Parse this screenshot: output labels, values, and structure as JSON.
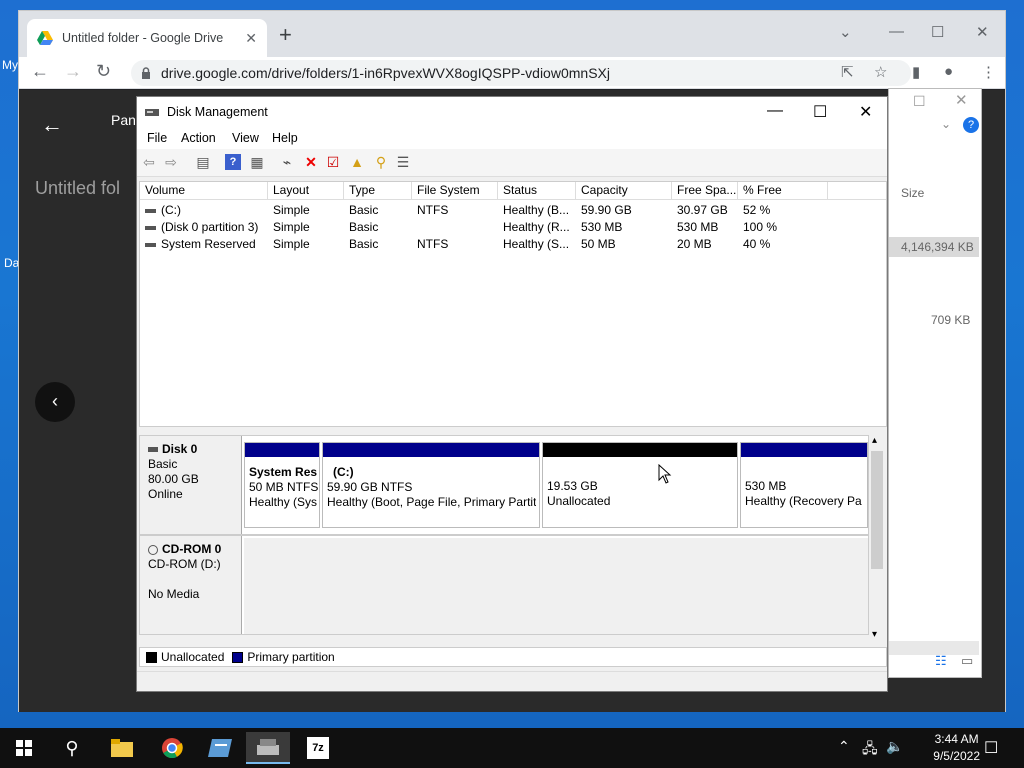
{
  "desktop": {
    "frag1": "My",
    "frag2": "Da"
  },
  "chrome": {
    "tab_title": "Untitled folder - Google Drive",
    "url": "drive.google.com/drive/folders/1-in6RpvexWVX8ogIQSPP-vdiow0mnSXj",
    "new_tab_label": "+",
    "drive_title": "Untitled fol",
    "drive_file_frag": "Pan"
  },
  "explorer": {
    "col_size": "Size",
    "size1": "4,146,394 KB",
    "size2": "709 KB"
  },
  "dm": {
    "title": "Disk Management",
    "menu": [
      "File",
      "Action",
      "View",
      "Help"
    ],
    "columns": [
      "Volume",
      "Layout",
      "Type",
      "File System",
      "Status",
      "Capacity",
      "Free Spa...",
      "% Free"
    ],
    "rows": [
      [
        "(C:)",
        "Simple",
        "Basic",
        "NTFS",
        "Healthy (B...",
        "59.90 GB",
        "30.97 GB",
        "52 %"
      ],
      [
        "(Disk 0 partition 3)",
        "Simple",
        "Basic",
        "",
        "Healthy (R...",
        "530 MB",
        "530 MB",
        "100 %"
      ],
      [
        "System Reserved",
        "Simple",
        "Basic",
        "NTFS",
        "Healthy (S...",
        "50 MB",
        "20 MB",
        "40 %"
      ]
    ],
    "disk0": {
      "name": "Disk 0",
      "type": "Basic",
      "size": "80.00 GB",
      "state": "Online"
    },
    "partitions": [
      {
        "name": "System Res",
        "size": "50 MB NTFS",
        "status": "Healthy (Sys",
        "kind": "primary"
      },
      {
        "name": "(C:)",
        "size": "59.90 GB NTFS",
        "status": "Healthy (Boot, Page File, Primary Partit",
        "kind": "primary"
      },
      {
        "name": "",
        "size": "19.53 GB",
        "status": "Unallocated",
        "kind": "unallocated"
      },
      {
        "name": "",
        "size": "530 MB",
        "status": "Healthy (Recovery Pa",
        "kind": "primary"
      }
    ],
    "cdrom": {
      "name": "CD-ROM 0",
      "type": "CD-ROM (D:)",
      "media": "No Media"
    },
    "legend": {
      "unallocated": "Unallocated",
      "primary": "Primary partition"
    },
    "colors": {
      "primary": "#00008b",
      "unallocated": "#000000"
    }
  },
  "taskbar": {
    "time": "3:44 AM",
    "date": "9/5/2022"
  }
}
